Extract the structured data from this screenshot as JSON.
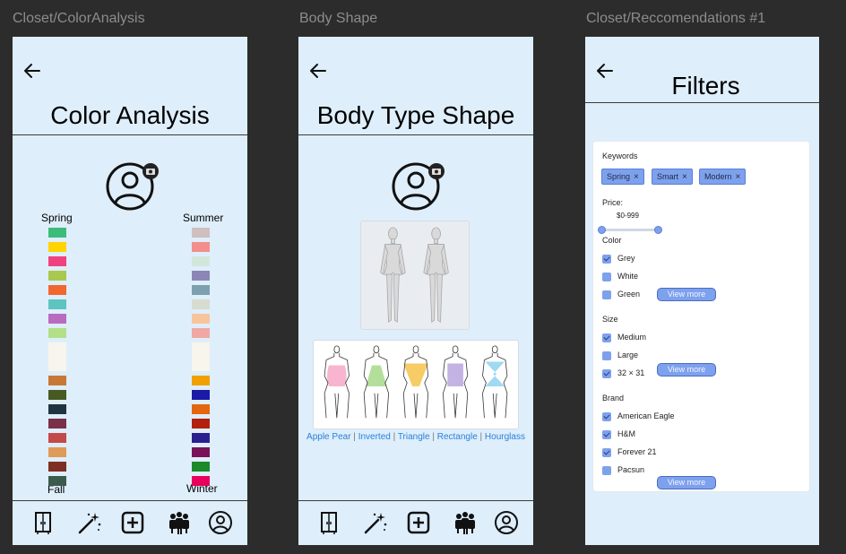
{
  "frames": {
    "color": {
      "label": "Closet/ColorAnalysis",
      "title": "Color Analysis"
    },
    "body": {
      "label": "Body Shape",
      "title": "Body Type Shape"
    },
    "recs": {
      "label": "Closet/Reccomendations #1",
      "title": "Filters"
    }
  },
  "color_analysis": {
    "seasons": {
      "spring": "Spring",
      "summer": "Summer",
      "fall": "Fall",
      "winter": "Winter"
    },
    "left_swatches": [
      "#3cbc7c",
      "#ffd400",
      "#f0427f",
      "#a9c84e",
      "#f2672e",
      "#5ec4c0",
      "#b86bbf",
      "#b2e086",
      "#f8f5ec",
      "#c87836",
      "#485a23",
      "#1f3340",
      "#7a3148",
      "#c44a4a",
      "#e09a58",
      "#7e2e22",
      "#3b5b4c"
    ],
    "right_swatches": [
      "#cfbfbe",
      "#f28e8b",
      "#d3e6dc",
      "#8c86b6",
      "#7d9fb0",
      "#d7dccf",
      "#f7c59c",
      "#f1a7a4",
      "#f8f5ec",
      "#f0a000",
      "#1a1aa6",
      "#e36610",
      "#b2210e",
      "#2a1f8f",
      "#7a125a",
      "#1a8a2a",
      "#e8005c"
    ]
  },
  "body_shape": {
    "labels": [
      "Apple",
      "Pear",
      "Inverted",
      "Triangle",
      "Rectangle",
      "Hourglass"
    ],
    "shape_colors": [
      "#f7a8c8",
      "#a6d98a",
      "#f6c24a",
      "#b8a6e0",
      "#8fd2f0"
    ]
  },
  "filters": {
    "keywords_label": "Keywords",
    "chips": [
      "Spring",
      "Smart",
      "Modern"
    ],
    "chip_close": "×",
    "price_label": "Price:",
    "price_range": "$0-999",
    "color_label": "Color",
    "color_opts": [
      "Grey",
      "White",
      "Green"
    ],
    "size_label": "Size",
    "size_opts": [
      "Medium",
      "Large",
      "32 × 31"
    ],
    "brand_label": "Brand",
    "brand_opts": [
      "American Eagle",
      "H&M",
      "Forever 21",
      "Pacsun"
    ],
    "view_more": "View more"
  },
  "nav": [
    "closet-icon",
    "magic-wand-icon",
    "add-icon",
    "community-icon",
    "profile-icon"
  ]
}
